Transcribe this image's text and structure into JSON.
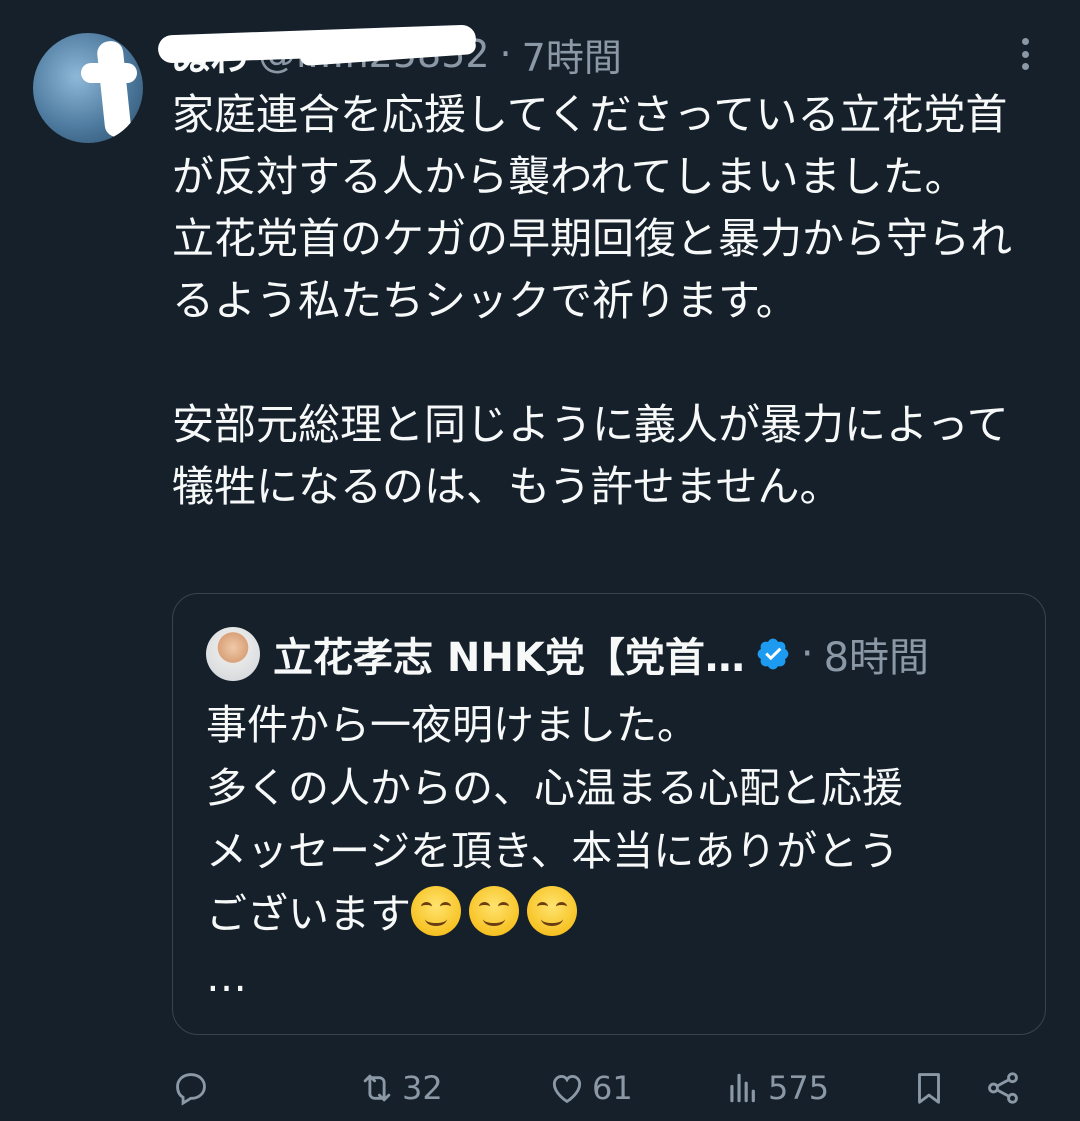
{
  "author": {
    "display_name": "ぬわ",
    "handle": "@i…h25852",
    "time": "7時間"
  },
  "tweet_text": "家庭連合を応援してくださっている立花党首が反対する人から襲われてしまいました。\n立花党首のケガの早期回復と暴力から守られるよう私たちシックで祈ります。\n\n安部元総理と同じように義人が暴力によって犠牲になるのは、もう許せません。",
  "quote": {
    "display_name": "立花孝志 NHK党【党首…",
    "time": "8時間",
    "text_line1": "事件から一夜明けました。",
    "text_line2": "多くの人からの、心温まる心配と応援",
    "text_line3": "メッセージを頂き、本当にありがとう",
    "text_line4": "ございます",
    "emoji": [
      "😊",
      "😊",
      "😊"
    ],
    "more": "…"
  },
  "actions": {
    "reply_count": "",
    "retweet_count": "32",
    "like_count": "61",
    "view_count": "575"
  },
  "icons": [
    "more-icon",
    "verified-icon",
    "reply-icon",
    "retweet-icon",
    "like-icon",
    "views-icon",
    "bookmark-icon",
    "share-icon"
  ],
  "colors": {
    "background": "#15202b",
    "text": "#f7f9f9",
    "muted": "#8b98a5",
    "verified": "#1d9bf0",
    "border": "#38444d"
  }
}
